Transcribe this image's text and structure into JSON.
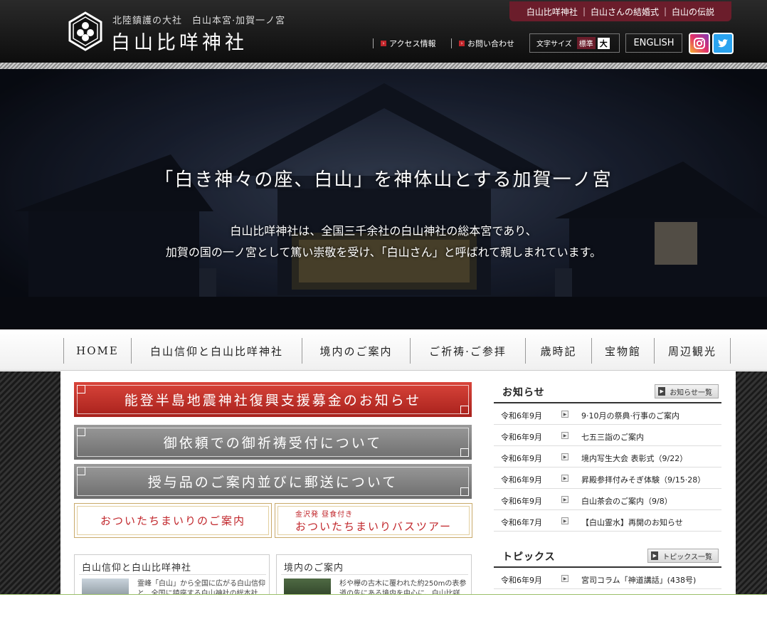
{
  "header": {
    "subtitle": "北陸鎮護の大社　白山本宮·加賀一ノ宮",
    "site_name": "白山比咩神社",
    "top_links": [
      "白山比咩神社",
      "白山さんの結婚式",
      "白山の伝説"
    ],
    "utility_links": [
      "アクセス情報",
      "お問い合わせ"
    ],
    "font_size": {
      "label": "文字サイズ",
      "standard": "標準",
      "large": "大"
    },
    "english": "ENGLISH",
    "sns": [
      "instagram-icon",
      "twitter-icon"
    ]
  },
  "hero": {
    "headline": "「白き神々の座、白山」を神体山とする加賀一ノ宮",
    "body_line1": "白山比咩神社は、全国三千余社の白山神社の総本宮であり、",
    "body_line2": "加賀の国の一ノ宮として篤い崇敬を受け、「白山さん」と呼ばれて親しまれています。"
  },
  "nav": {
    "items": [
      {
        "label": "HOME"
      },
      {
        "label": "白山信仰と白山比咩神社"
      },
      {
        "label": "境内のご案内"
      },
      {
        "label": "ご祈祷·ご参拝"
      },
      {
        "label": "歳時記"
      },
      {
        "label": "宝物館"
      },
      {
        "label": "周辺観光"
      }
    ]
  },
  "banners": {
    "b1": "能登半島地震神社復興支援募金のお知らせ",
    "b2": "御依頼での御祈祷受付について",
    "b3": "授与品のご案内並びに郵送について",
    "s1": "おついたちまいりのご案内",
    "s2_tag": "金沢発 昼食付き",
    "s2": "おついたちまいりバスツアー"
  },
  "cards": [
    {
      "title": "白山信仰と白山比咩神社",
      "text": "霊峰「白山」から全国に広がる白山信仰と、全国に鎮座する白山神社の総本社"
    },
    {
      "title": "境内のご案内",
      "text": "杉や欅の古木に覆われた約250mの表参道の先にある境内を中心に、白山比咩"
    }
  ],
  "news": {
    "title": "お知らせ",
    "more": "お知らせ一覧",
    "items": [
      {
        "date": "令和6年9月",
        "title": "9·10月の祭典·行事のご案内"
      },
      {
        "date": "令和6年9月",
        "title": "七五三詣のご案内"
      },
      {
        "date": "令和6年9月",
        "title": "境内写生大会 表彰式（9/22）"
      },
      {
        "date": "令和6年9月",
        "title": "昇殿参拝付みそぎ体験（9/15·28）"
      },
      {
        "date": "令和6年9月",
        "title": "白山茶会のご案内（9/8）"
      },
      {
        "date": "令和6年7月",
        "title": "【白山霊水】再開のお知らせ"
      }
    ]
  },
  "topics": {
    "title": "トピックス",
    "more": "トピックス一覧",
    "items": [
      {
        "date": "令和6年9月",
        "title": "宮司コラム「神道講話」(438号)"
      }
    ]
  },
  "colors": {
    "accent": "#6b1d2b",
    "red": "#c1262b",
    "gold": "#c9a96a"
  }
}
